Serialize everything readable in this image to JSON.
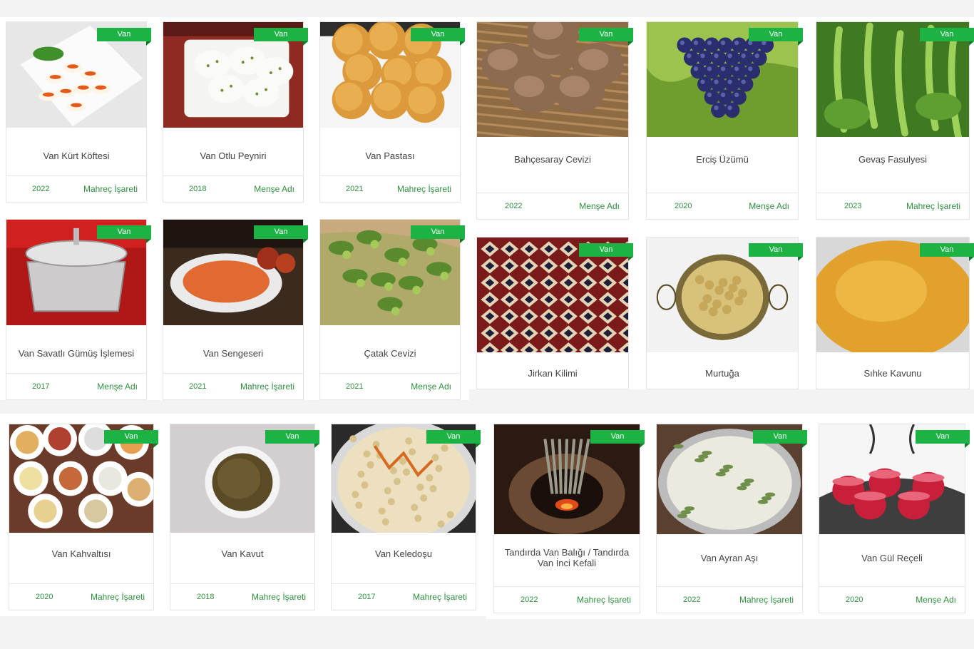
{
  "badge_label": "Van",
  "colors": {
    "accent": "#1db344",
    "link": "#2f8f3f",
    "text": "#444444",
    "page_bg": "#f3f3f4"
  },
  "products": [
    {
      "name": "Van Kürt Köftesi",
      "year": "2022",
      "type": "Mahreç İşareti",
      "image": "plate-of-kofte"
    },
    {
      "name": "Van Otlu Peyniri",
      "year": "2018",
      "type": "Menşe Adı",
      "image": "herb-cheese"
    },
    {
      "name": "Van Pastası",
      "year": "2021",
      "type": "Mahreç İşareti",
      "image": "round-pastries"
    },
    {
      "name": "Van Savatlı Gümüş İşlemesi",
      "year": "2017",
      "type": "Menşe Adı",
      "image": "silver-box"
    },
    {
      "name": "Van Sengeseri",
      "year": "2021",
      "type": "Mahreç İşareti",
      "image": "red-paste-dish"
    },
    {
      "name": "Çatak Cevizi",
      "year": "2021",
      "type": "Menşe Adı",
      "image": "walnut-tree"
    },
    {
      "name": "Bahçesaray Cevizi",
      "year": "2022",
      "type": "Menşe Adı",
      "image": "walnuts"
    },
    {
      "name": "Erciş Üzümü",
      "year": "2020",
      "type": "Menşe Adı",
      "image": "grapes"
    },
    {
      "name": "Gevaş Fasulyesi",
      "year": "2023",
      "type": "Mahreç İşareti",
      "image": "green-beans"
    },
    {
      "name": "Jirkan Kilimi",
      "year": "",
      "type": "",
      "image": "kilim-rug"
    },
    {
      "name": "Murtuğa",
      "year": "",
      "type": "",
      "image": "copper-pan"
    },
    {
      "name": "Sıhke Kavunu",
      "year": "",
      "type": "",
      "image": "yellow-melon"
    },
    {
      "name": "Van Kahvaltısı",
      "year": "2020",
      "type": "Mahreç İşareti",
      "image": "breakfast-spread"
    },
    {
      "name": "Van Kavut",
      "year": "2018",
      "type": "Mahreç İşareti",
      "image": "kavut-bowl"
    },
    {
      "name": "Van Keledoşu",
      "year": "2017",
      "type": "Mahreç İşareti",
      "image": "keledos-plate"
    },
    {
      "name": "Tandırda Van Balığı / Tandırda Van İnci Kefali",
      "year": "2022",
      "type": "Mahreç İşareti",
      "image": "tandir-fish"
    },
    {
      "name": "Van Ayran Aşı",
      "year": "2022",
      "type": "Mahreç İşareti",
      "image": "ayran-soup"
    },
    {
      "name": "Van Gül Reçeli",
      "year": "2020",
      "type": "Menşe Adı",
      "image": "rose-jam"
    }
  ]
}
